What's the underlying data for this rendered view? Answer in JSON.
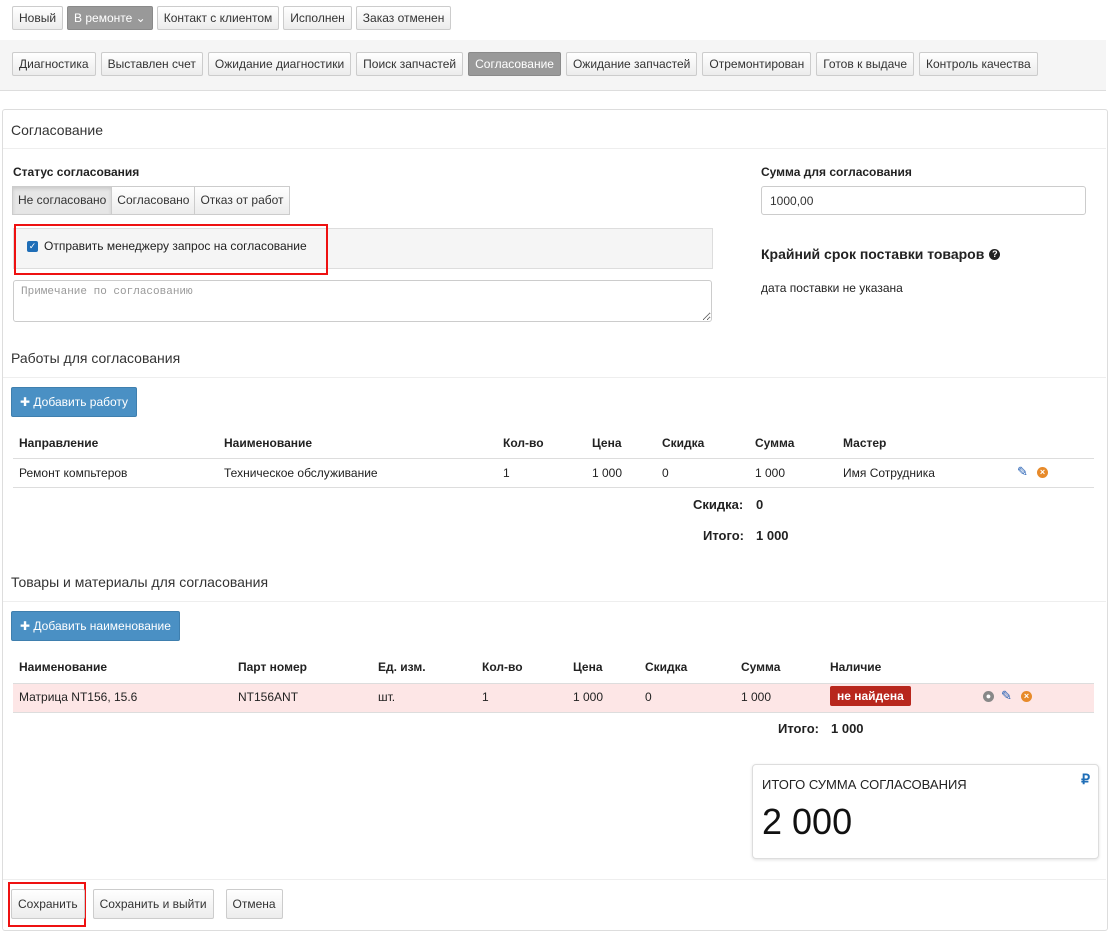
{
  "status_row": [
    {
      "label": "Новый",
      "active": false
    },
    {
      "label": "В ремонте",
      "active": true,
      "dropdown": "⌄"
    },
    {
      "label": "Контакт с клиентом",
      "active": false
    },
    {
      "label": "Исполнен",
      "active": false
    },
    {
      "label": "Заказ отменен",
      "active": false
    }
  ],
  "substatus_row": [
    {
      "label": "Диагностика",
      "active": false
    },
    {
      "label": "Выставлен счет",
      "active": false
    },
    {
      "label": "Ожидание диагностики",
      "active": false
    },
    {
      "label": "Поиск запчастей",
      "active": false
    },
    {
      "label": "Согласование",
      "active": true
    },
    {
      "label": "Ожидание запчастей",
      "active": false
    },
    {
      "label": "Отремонтирован",
      "active": false
    },
    {
      "label": "Готов к выдаче",
      "active": false
    },
    {
      "label": "Контроль качества",
      "active": false
    }
  ],
  "panel": {
    "title": "Согласование",
    "approval_status_label": "Статус согласования",
    "approval_options": [
      "Не согласовано",
      "Согласовано",
      "Отказ от работ"
    ],
    "approval_selected": "Не согласовано",
    "send_request_label": "Отправить менеджеру запрос на согласование",
    "send_request_checked": true,
    "note_placeholder": "Примечание по согласованию",
    "sum_label": "Сумма для согласования",
    "sum_value": "1000,00",
    "deadline_title": "Крайний срок поставки товаров",
    "deadline_value": "дата поставки не указана"
  },
  "works": {
    "title": "Работы для согласования",
    "add_button": "Добавить работу",
    "headers": [
      "Направление",
      "Наименование",
      "Кол-во",
      "Цена",
      "Скидка",
      "Сумма",
      "Мастер"
    ],
    "rows": [
      [
        "Ремонт компьтеров",
        "Техническое обслуживание",
        "1",
        "1 000",
        "0",
        "1 000",
        "Имя Сотрудника"
      ]
    ],
    "discount_label": "Скидка:",
    "discount_value": "0",
    "total_label": "Итого:",
    "total_value": "1 000"
  },
  "goods": {
    "title": "Товары и материалы для согласования",
    "add_button": "Добавить наименование",
    "headers": [
      "Наименование",
      "Парт номер",
      "Ед. изм.",
      "Кол-во",
      "Цена",
      "Скидка",
      "Сумма",
      "Наличие"
    ],
    "rows": [
      [
        "Матрица NT156, 15.6",
        "NT156ANT",
        "шт.",
        "1",
        "1 000",
        "0",
        "1 000",
        "не найдена"
      ]
    ],
    "total_label": "Итого:",
    "total_value": "1 000"
  },
  "summary": {
    "label": "ИТОГО СУММА СОГЛАСОВАНИЯ",
    "value": "2 000",
    "currency": "₽"
  },
  "footer": {
    "save": "Сохранить",
    "save_exit": "Сохранить и выйти",
    "cancel": "Отмена"
  },
  "colors": {
    "accent": "#4a90c4",
    "danger": "#b8271d",
    "highlight": "#e11111",
    "row_warning": "#fde6e6"
  },
  "icons": [
    "plus-icon",
    "pencil-icon",
    "delete-icon",
    "view-icon",
    "help-icon",
    "ruble-icon",
    "checkbox-checked-icon",
    "chevron-down-icon"
  ]
}
